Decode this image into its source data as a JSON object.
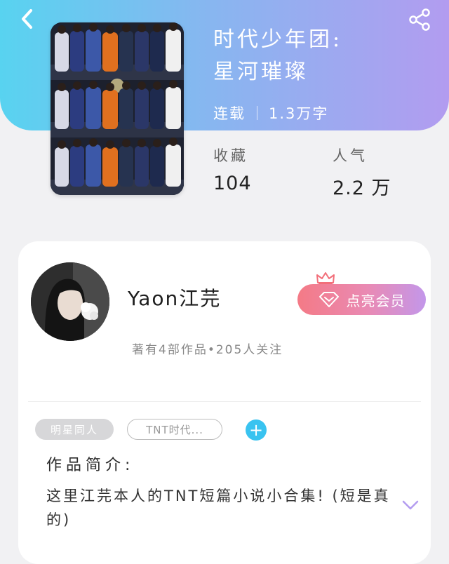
{
  "header": {
    "title_line1": "时代少年团:",
    "title_line2": "星河璀璨",
    "status": "连载",
    "word_count": "1.3万字",
    "stats": [
      {
        "label": "收藏",
        "value": "104"
      },
      {
        "label": "人气",
        "value": "2.2 万"
      }
    ]
  },
  "author": {
    "name": "Yaon江芫",
    "stats": "著有4部作品•205人关注",
    "member_button": "点亮会员"
  },
  "tags": [
    "明星同人",
    "TNT时代..."
  ],
  "intro": {
    "title": "作品简介:",
    "text": "这里江芫本人的TNT短篇小说小合集!  (短是真的)"
  },
  "colors": {
    "header_start": "#58d3f0",
    "header_end": "#b29cf0",
    "accent_blue": "#39c3f0",
    "member_pink": "#f47a86",
    "member_purple": "#c397ea"
  },
  "icons": [
    "back-arrow-icon",
    "share-icon",
    "crown-icon",
    "diamond-icon",
    "plus-icon",
    "chevron-down-icon"
  ]
}
